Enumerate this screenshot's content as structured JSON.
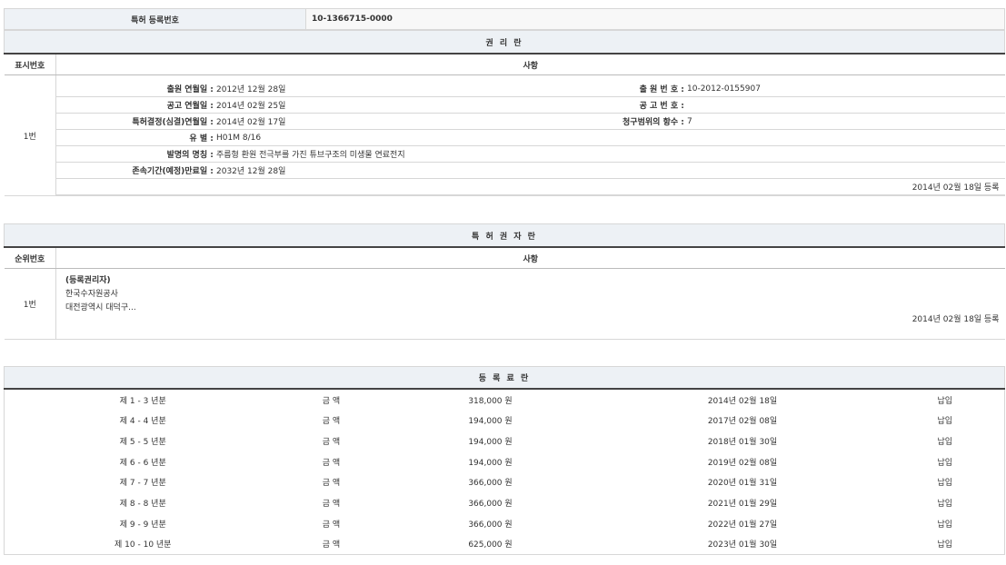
{
  "patent_number": {
    "label": "특허 등록번호",
    "value": "10-1366715-0000"
  },
  "rights_section": {
    "title": "권 리 란",
    "col_index": "표시번호",
    "col_details": "사항",
    "entry": {
      "index": "1번",
      "left": [
        {
          "label": "출원 연월일",
          "value": "2012년 12월 28일"
        },
        {
          "label": "공고 연월일",
          "value": "2014년 02월 25일"
        },
        {
          "label": "특허결정(심결)연월일",
          "value": "2014년 02월 17일"
        },
        {
          "label": "유 별",
          "value": "H01M 8/16"
        },
        {
          "label": "발명의 명칭",
          "value": "주름형 환원 전극부를 가진 튜브구조의 미생물 연료전지"
        },
        {
          "label": "존속기간(예정)만료일",
          "value": "2032년 12월 28일"
        }
      ],
      "right": [
        {
          "label": "출 원 번 호",
          "value": "10-2012-0155907"
        },
        {
          "label": "공 고 번 호",
          "value": ""
        },
        {
          "label": "청구범위의 항수",
          "value": "7"
        }
      ],
      "registered": "2014년 02월 18일 등록"
    }
  },
  "holder_section": {
    "title": "특 허 권 자 란",
    "col_index": "순위번호",
    "col_details": "사항",
    "entry": {
      "index": "1번",
      "type": "(등록권리자)",
      "name": "한국수자원공사",
      "address": "대전광역시 대덕구...",
      "registered": "2014년 02월 18일 등록"
    }
  },
  "fees_section": {
    "title": "등 록 료 란",
    "rows": [
      {
        "period": "제 1 - 3 년분",
        "label": "금 액",
        "amount": "318,000 원",
        "date": "2014년 02월 18일",
        "status": "납입"
      },
      {
        "period": "제 4 - 4 년분",
        "label": "금 액",
        "amount": "194,000 원",
        "date": "2017년 02월 08일",
        "status": "납입"
      },
      {
        "period": "제 5 - 5 년분",
        "label": "금 액",
        "amount": "194,000 원",
        "date": "2018년 01월 30일",
        "status": "납입"
      },
      {
        "period": "제 6 - 6 년분",
        "label": "금 액",
        "amount": "194,000 원",
        "date": "2019년 02월 08일",
        "status": "납입"
      },
      {
        "period": "제 7 - 7 년분",
        "label": "금 액",
        "amount": "366,000 원",
        "date": "2020년 01월 31일",
        "status": "납입"
      },
      {
        "period": "제 8 - 8 년분",
        "label": "금 액",
        "amount": "366,000 원",
        "date": "2021년 01월 29일",
        "status": "납입"
      },
      {
        "period": "제 9 - 9 년분",
        "label": "금 액",
        "amount": "366,000 원",
        "date": "2022년 01월 27일",
        "status": "납입"
      },
      {
        "period": "제 10 - 10 년분",
        "label": "금 액",
        "amount": "625,000 원",
        "date": "2023년 01월 30일",
        "status": "납입"
      }
    ]
  }
}
